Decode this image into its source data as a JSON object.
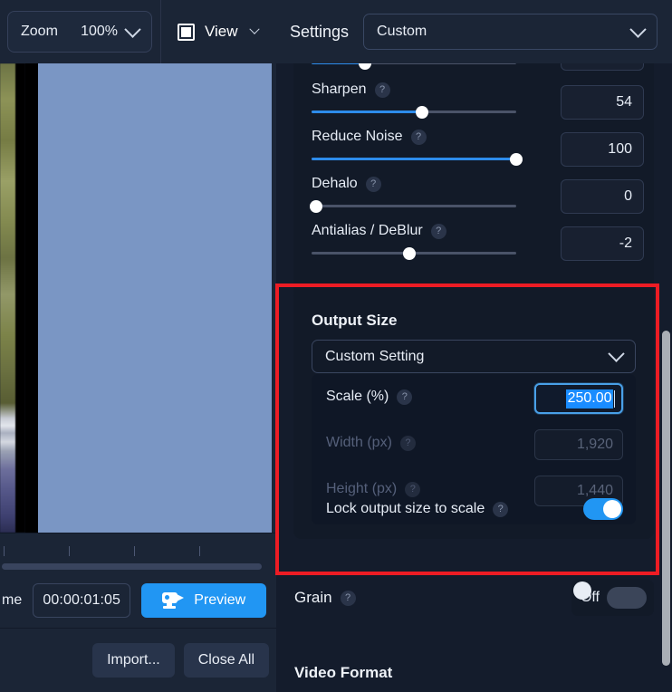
{
  "left_panel": {
    "zoom_control": {
      "label": "Zoom",
      "value": "100%",
      "icon": "chevron-down-icon"
    },
    "view_control": {
      "label": "View",
      "icon": "square-frame-icon",
      "caret": "chevron-down-icon"
    },
    "frame_label": "me",
    "timecode_value": "00:00:01:05",
    "preview_button": {
      "label": "Preview",
      "icon": "video-camera-icon"
    },
    "import_button": "Import...",
    "close_all_button": "Close All"
  },
  "settings_header": {
    "title": "Settings",
    "preset_value": "Custom",
    "caret": "chevron-down-icon"
  },
  "sliders": [
    {
      "label": "",
      "value": "",
      "fill_pct": 26,
      "partial": true,
      "help": "?"
    },
    {
      "label": "Sharpen",
      "value": "54",
      "fill_pct": 54,
      "help": "?"
    },
    {
      "label": "Reduce Noise",
      "value": "100",
      "fill_pct": 100,
      "help": "?"
    },
    {
      "label": "Dehalo",
      "value": "0",
      "fill_pct": 2,
      "help": "?"
    },
    {
      "label": "Antialias / DeBlur",
      "value": "-2",
      "fill_pct": 48,
      "help": "?",
      "no_fill": true
    }
  ],
  "output_size": {
    "title": "Output Size",
    "preset_value": "Custom Setting",
    "caret": "chevron-down-icon",
    "rows": [
      {
        "label": "Scale (%)",
        "value": "250.00",
        "help": "?",
        "state": "active-selected"
      },
      {
        "label": "Width (px)",
        "value": "1,920",
        "help": "?",
        "state": "disabled"
      },
      {
        "label": "Height (px)",
        "value": "1,440",
        "help": "?",
        "state": "disabled"
      }
    ],
    "lock_row": {
      "label": "Lock output size to scale",
      "help": "?",
      "toggle": "on"
    }
  },
  "grain": {
    "label": "Grain",
    "help": "?",
    "toggle_state_label": "Off",
    "toggle": "off"
  },
  "video_format": {
    "title": "Video Format"
  },
  "colors": {
    "accent_blue": "#2196f3",
    "slider_blue": "#2d8ceb",
    "highlight_red": "#ed1c24",
    "selection_blue": "#1a8cff",
    "panel_bg": "#1b2536",
    "card_bg": "#121a28",
    "preview_fill": "#7a96c4"
  }
}
